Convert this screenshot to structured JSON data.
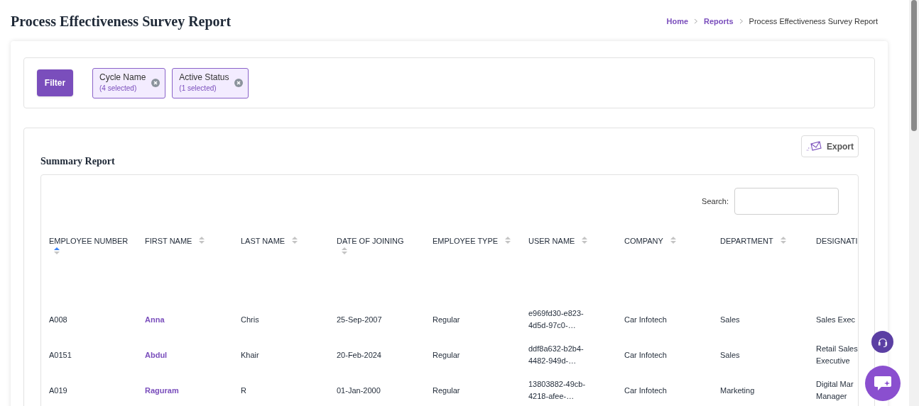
{
  "page_title": "Process Effectiveness Survey Report",
  "breadcrumb": [
    {
      "label": "Home",
      "link": true
    },
    {
      "label": "Reports",
      "link": true
    },
    {
      "label": "Process Effectiveness Survey Report",
      "link": false
    }
  ],
  "filter": {
    "button": "Filter",
    "chips": [
      {
        "label": "Cycle Name",
        "count": "(4 selected)"
      },
      {
        "label": "Active Status",
        "count": "(1 selected)"
      }
    ]
  },
  "summary": {
    "title": "Summary Report",
    "export": "Export",
    "search_label": "Search:",
    "columns": [
      {
        "label": "EMPLOYEE NUMBER",
        "sorted_ascending": true,
        "kind": "text"
      },
      {
        "label": "FIRST NAME",
        "sorted_ascending": false,
        "kind": "link"
      },
      {
        "label": "LAST NAME",
        "sorted_ascending": false,
        "kind": "text"
      },
      {
        "label": "DATE OF JOINING",
        "sorted_ascending": false,
        "kind": "text"
      },
      {
        "label": "EMPLOYEE TYPE",
        "sorted_ascending": false,
        "kind": "text"
      },
      {
        "label": "USER NAME",
        "sorted_ascending": false,
        "kind": "text"
      },
      {
        "label": "COMPANY",
        "sorted_ascending": false,
        "kind": "text"
      },
      {
        "label": "DEPARTMENT",
        "sorted_ascending": false,
        "kind": "text"
      },
      {
        "label": "DESIGNATI",
        "kind": "text"
      }
    ],
    "rows": [
      [
        "A008",
        "Anna",
        "Chris",
        "25-Sep-2007",
        "Regular",
        "e969fd30-e823-4d5d-97c0-…",
        "Car Infotech",
        "Sales",
        "Sales Exec"
      ],
      [
        "A0151",
        "Abdul",
        "Khair",
        "20-Feb-2024",
        "Regular",
        "ddf8a632-b2b4-4482-949d-…",
        "Car Infotech",
        "Sales",
        "Retail Sales Executive"
      ],
      [
        "A019",
        "Raguram",
        "R",
        "01-Jan-2000",
        "Regular",
        "13803882-49cb-4218-afee-…",
        "Car Infotech",
        "Marketing",
        "Digital Mar Manager"
      ]
    ]
  }
}
